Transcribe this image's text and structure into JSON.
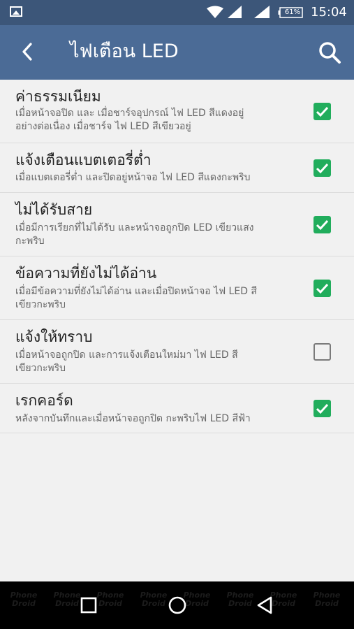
{
  "status_bar": {
    "time": "15:04",
    "battery": "61%"
  },
  "app_bar": {
    "title": "ไฟเตือน LED"
  },
  "settings": [
    {
      "title": "ค่าธรรมเนียม",
      "desc_lines": [
        "เมื่อหน้าจอปิด และ เมื่อชาร์จอุปกรณ์ ไฟ LED สีแดงอยู่",
        "อย่างต่อเนื่อง เมื่อชาร์จ ไฟ LED สีเขียวอยู่"
      ],
      "checked": true
    },
    {
      "title": "แจ้งเตือนแบตเตอรี่ต่ำ",
      "desc_lines": [
        "เมื่อแบตเตอรี่ต่ำ และปิดอยู่หน้าจอ ไฟ LED สีแดงกะพริบ"
      ],
      "checked": true
    },
    {
      "title": "ไม่ได้รับสาย",
      "desc_lines": [
        "เมื่อมีการเรียกที่ไม่ได้รับ และหน้าจอถูกปิด LED เขียวแสง",
        "กะพริบ"
      ],
      "checked": true
    },
    {
      "title": "ข้อความที่ยังไม่ได้อ่าน",
      "desc_lines": [
        "เมื่อมีข้อความที่ยังไม่ได้อ่าน และเมื่อปิดหน้าจอ ไฟ LED สี",
        "เขียวกะพริบ"
      ],
      "checked": true
    },
    {
      "title": "แจ้งให้ทราบ",
      "desc_lines": [
        "เมื่อหน้าจอถูกปิด และการแจ้งเตือนใหม่มา ไฟ LED สี",
        "เขียวกะพริบ"
      ],
      "checked": false
    },
    {
      "title": "เรกคอร์ด",
      "desc_lines": [
        "หลังจากบันทึกและเมื่อหน้าจอถูกปิด กะพริบไฟ LED สีฟ้า"
      ],
      "checked": true
    }
  ],
  "watermark": {
    "line1": "Phone",
    "line2": "Droid"
  },
  "colors": {
    "status_bar": "#3c5679",
    "app_bar": "#4b6b96",
    "checkbox_on": "#21ad5c",
    "background": "#f1f1f1"
  },
  "icons": {
    "back": "arrow-left-icon",
    "search": "search-icon",
    "nav_recent": "square-icon",
    "nav_home": "circle-icon",
    "nav_back": "triangle-back-icon"
  }
}
